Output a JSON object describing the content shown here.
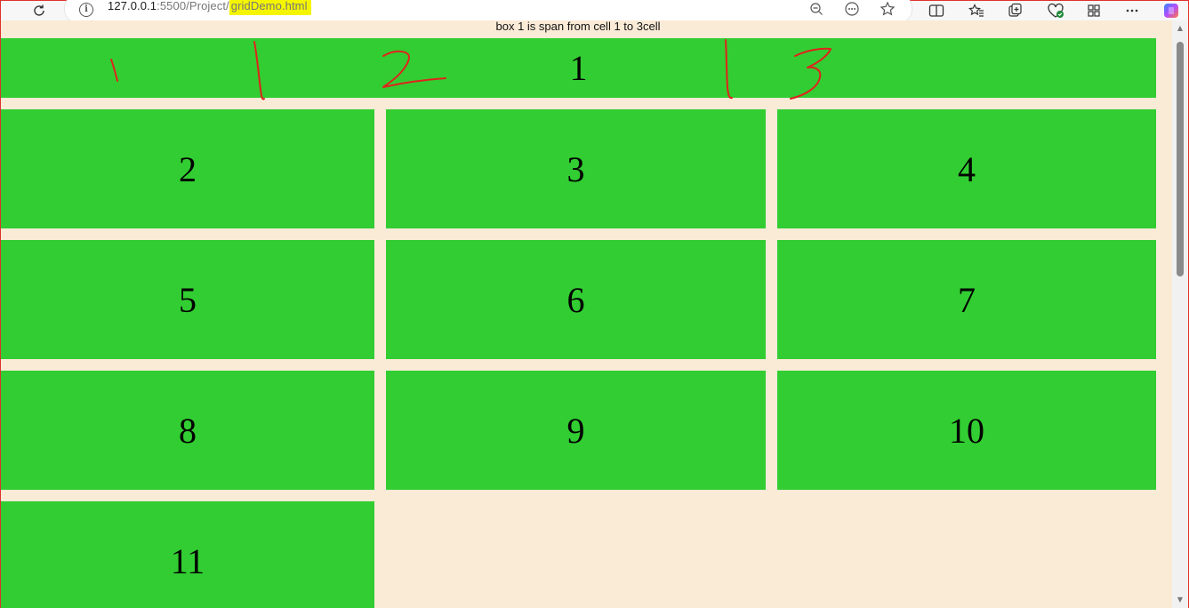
{
  "browser": {
    "url_host": "127.0.0.1",
    "url_path": ":5500/Project/",
    "url_file": "gridDemo.html",
    "icons": [
      "reload-icon",
      "info-icon",
      "zoom-out-icon",
      "page-actions-icon",
      "favorite-icon",
      "split-screen-icon",
      "favorites-icon",
      "collections-icon",
      "browser-essentials-icon",
      "extensions-icon",
      "more-icon",
      "copilot-icon"
    ],
    "highlight_color": "#f5f500"
  },
  "page": {
    "annotation": "box 1 is span from cell 1  to 3cell",
    "background": "#faebd7",
    "box_color": "#32cd32",
    "boxes": [
      {
        "label": "1"
      },
      {
        "label": "2"
      },
      {
        "label": "3"
      },
      {
        "label": "4"
      },
      {
        "label": "5"
      },
      {
        "label": "6"
      },
      {
        "label": "7"
      },
      {
        "label": "8"
      },
      {
        "label": "9"
      },
      {
        "label": "10"
      },
      {
        "label": "11"
      }
    ],
    "scribble_color": "#e0231c"
  }
}
